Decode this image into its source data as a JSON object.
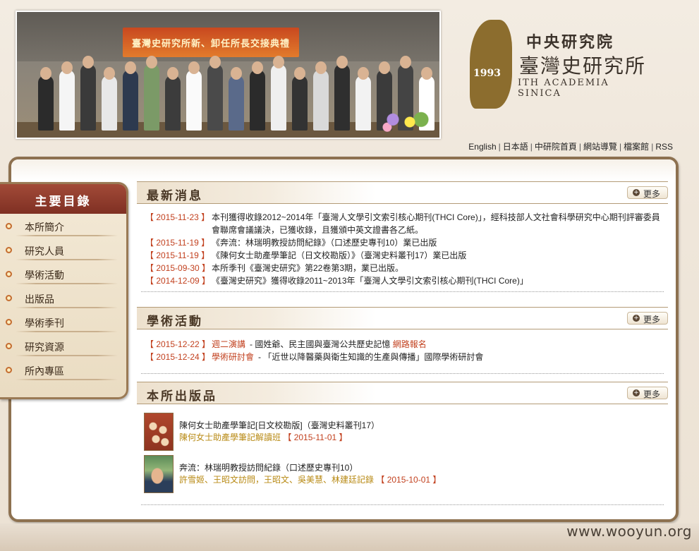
{
  "header": {
    "banner_sign": "臺灣史研究所新、卸任所長交接典禮",
    "logo": {
      "mark_year": "1993",
      "cn_top": "中央研究院",
      "cn_main": "臺灣史研究所",
      "en": "ITH ACADEMIA SINICA"
    },
    "top_links": [
      "English",
      "日本語",
      "中研院首頁",
      "網站導覽",
      "檔案館",
      "RSS"
    ]
  },
  "sidebar": {
    "title": "主要目錄",
    "items": [
      "本所簡介",
      "研究人員",
      "學術活動",
      "出版品",
      "學術季刊",
      "研究資源",
      "所內專區"
    ]
  },
  "sections": {
    "news": {
      "title": "最新消息",
      "more": "更多",
      "items": [
        {
          "date": "【 2015-11-23 】",
          "text": "本刊獲得收錄2012~2014年「臺灣人文學引文索引核心期刊(THCI Core)」，經科技部人文社會科學研究中心期刊評審委員會聯席會議議決，已獲收錄，且獲頒中英文證書各乙紙。"
        },
        {
          "date": "【 2015-11-19 】",
          "text": "《奔流：林瑞明教授訪問紀錄》（口述歷史專刊10）業已出版"
        },
        {
          "date": "【 2015-11-19 】",
          "text": "《陳何女士助產學筆記（日文校勘版）》（臺灣史料叢刊17）業已出版"
        },
        {
          "date": "【 2015-09-30 】",
          "text": "本所季刊《臺灣史研究》第22卷第3期，業已出版。"
        },
        {
          "date": "【 2014-12-09 】",
          "text": "《臺灣史研究》獲得收錄2011~2013年「臺灣人文學引文索引核心期刊(THCI Core)」"
        }
      ]
    },
    "activities": {
      "title": "學術活動",
      "more": "更多",
      "items": [
        {
          "date": "【 2015-12-22 】",
          "tag": "週二演講",
          "text": "- 國姓爺、民主國與臺灣公共歷史記憶",
          "link": "網路報名"
        },
        {
          "date": "【 2015-12-24 】",
          "tag": "學術研討會",
          "text": "- 「近世以降醫藥與衛生知識的生產與傳播」國際學術研討會",
          "link": ""
        }
      ]
    },
    "publications": {
      "title": "本所出版品",
      "more": "更多",
      "items": [
        {
          "title": "陳何女士助產學筆記[日文校勘版]（臺灣史料叢刊17）",
          "authors": "陳何女士助產學筆記解讀班",
          "date": "【 2015-11-01 】"
        },
        {
          "title": "奔流：林瑞明教授訪問紀錄（口述歷史專刊10）",
          "authors": "許雪姬、王昭文訪問，王昭文、吳美慧、林建廷記錄",
          "date": "【 2015-10-01 】"
        }
      ]
    }
  },
  "watermark": "www.wooyun.org"
}
